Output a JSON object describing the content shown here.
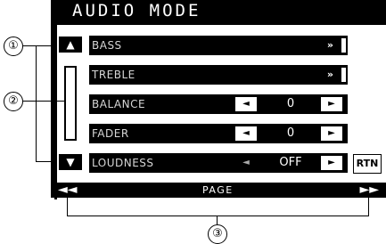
{
  "title": "AUDIO MODE",
  "rows": [
    {
      "label": "BASS",
      "type": "sub",
      "action": "»"
    },
    {
      "label": "TREBLE",
      "type": "sub",
      "action": "»"
    },
    {
      "label": "BALANCE",
      "type": "value",
      "left": "◄",
      "value": "0",
      "right": "►"
    },
    {
      "label": "FADER",
      "type": "value",
      "left": "◄",
      "value": "0",
      "right": "►"
    },
    {
      "label": "LOUDNESS",
      "type": "value",
      "left": "◄",
      "value": "OFF",
      "right": "►"
    }
  ],
  "scroll": {
    "up": "▲",
    "down": "▼"
  },
  "rtn_label": "RTN",
  "page_bar": {
    "prev": "◄◄",
    "label": "PAGE",
    "next": "►►"
  },
  "callouts": [
    "①",
    "②",
    "③"
  ]
}
